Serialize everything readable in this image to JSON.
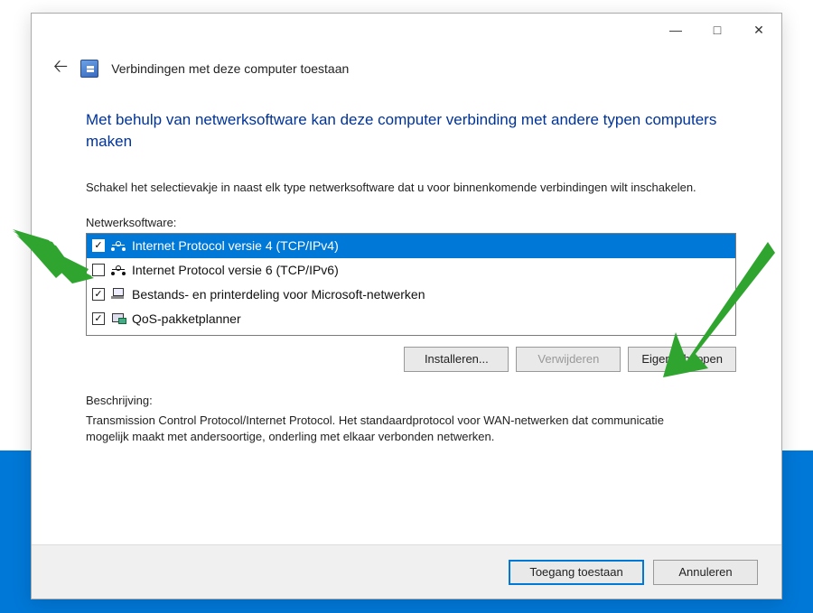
{
  "window": {
    "title": "Verbindingen met deze computer toestaan",
    "controls": {
      "minimize": "—",
      "maximize": "□",
      "close": "✕"
    }
  },
  "headline": "Met behulp van netwerksoftware kan deze computer verbinding met andere typen computers maken",
  "subtext": "Schakel het selectievakje in naast elk type netwerksoftware dat u voor binnenkomende verbindingen wilt inschakelen.",
  "list_label": "Netwerksoftware:",
  "items": [
    {
      "label": "Internet Protocol versie 4 (TCP/IPv4)",
      "checked": true,
      "selected": true,
      "icon": "net"
    },
    {
      "label": "Internet Protocol versie 6 (TCP/IPv6)",
      "checked": false,
      "selected": false,
      "icon": "net"
    },
    {
      "label": "Bestands- en printerdeling voor Microsoft-netwerken",
      "checked": true,
      "selected": false,
      "icon": "share"
    },
    {
      "label": "QoS-pakketplanner",
      "checked": true,
      "selected": false,
      "icon": "qos"
    }
  ],
  "buttons": {
    "install": "Installeren...",
    "remove": "Verwijderen",
    "properties": "Eigenschappen"
  },
  "description_label": "Beschrijving:",
  "description_text": "Transmission Control Protocol/Internet Protocol. Het standaardprotocol voor WAN-netwerken dat communicatie mogelijk maakt met andersoortige, onderling met elkaar verbonden netwerken.",
  "footer": {
    "allow": "Toegang toestaan",
    "cancel": "Annuleren"
  }
}
